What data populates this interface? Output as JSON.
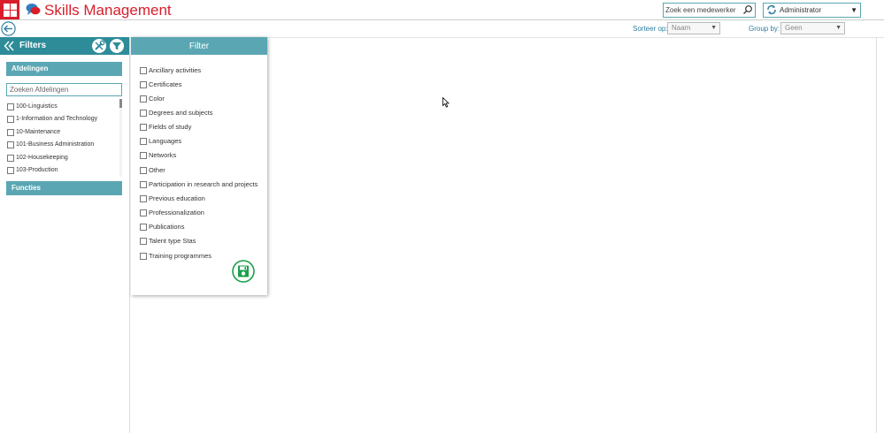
{
  "header": {
    "app_title": "Skills Management",
    "search_placeholder": "Zoek een medewerker",
    "role": "Administrator",
    "brand_color": "#d81e2b",
    "accent_color": "#2e8c99"
  },
  "toolbar": {
    "sort_label": "Sorteer op:",
    "sort_value": "Naam",
    "group_label": "Group by:",
    "group_value": "Geen"
  },
  "filters_panel": {
    "title": "Filters",
    "sections": {
      "afdelingen": "Afdelingen",
      "functies": "Functies"
    },
    "dept_search_placeholder": "Zoeken Afdelingen",
    "departments": [
      "100-Linguistics",
      "1-Information and Technology",
      "10-Maintenance",
      "101-Business Administration",
      "102-Housekeeping",
      "103-Production"
    ]
  },
  "filter_popup": {
    "title": "Filter",
    "items": [
      "Ancillary activities",
      "Certificates",
      "Color",
      "Degrees and subjects",
      "Fields of study",
      "Languages",
      "Networks",
      "Other",
      "Participation in research and projects",
      "Previous education",
      "Professionalization",
      "Publications",
      "Talent type Stas",
      "Training programmes"
    ]
  },
  "icons": [
    "apps-grid-icon",
    "chat-bubbles-logo-icon",
    "search-icon",
    "refresh-role-icon",
    "chevron-down-icon",
    "back-arrow-icon",
    "double-chevron-left-icon",
    "tools-icon",
    "filter-icon",
    "save-icon"
  ]
}
